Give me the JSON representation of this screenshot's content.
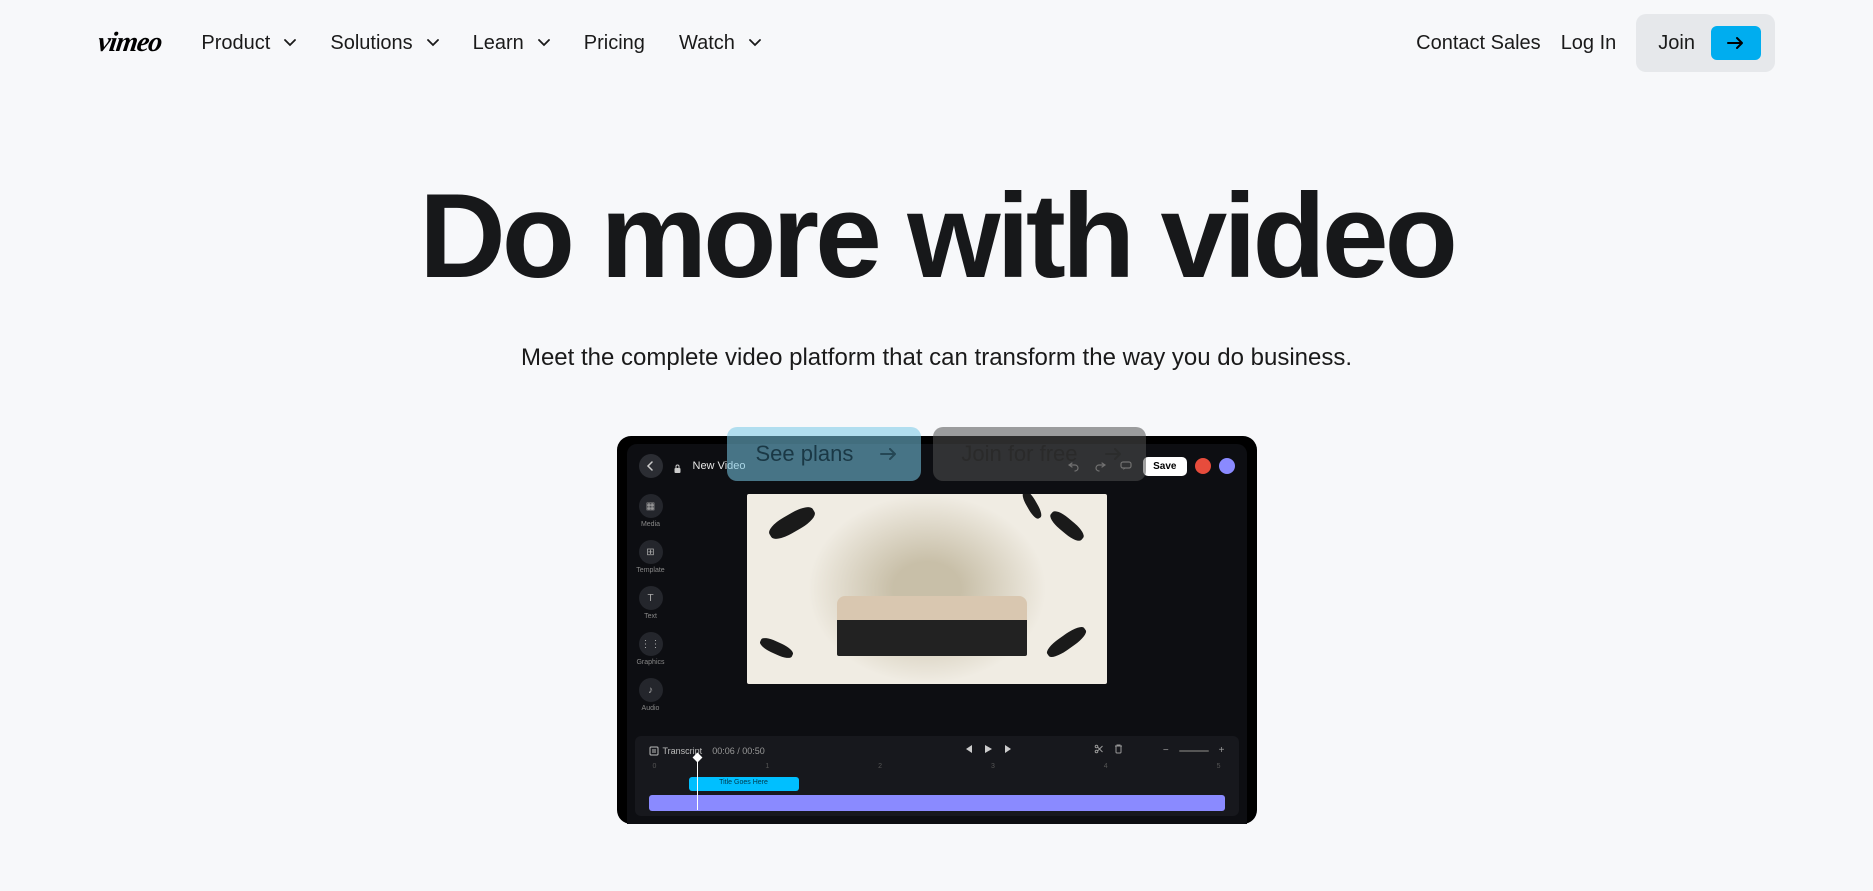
{
  "nav": {
    "logo": "vimeo",
    "items": [
      {
        "label": "Product",
        "hasDropdown": true
      },
      {
        "label": "Solutions",
        "hasDropdown": true
      },
      {
        "label": "Learn",
        "hasDropdown": true
      },
      {
        "label": "Pricing",
        "hasDropdown": false
      },
      {
        "label": "Watch",
        "hasDropdown": true
      }
    ],
    "contact": "Contact Sales",
    "login": "Log In",
    "join": "Join"
  },
  "hero": {
    "title": "Do more with video",
    "subtitle": "Meet the complete video platform that can transform the way you do business."
  },
  "cta": {
    "primary": "See plans",
    "secondary": "Join for free"
  },
  "editor": {
    "title": "New Video",
    "save": "Save",
    "rail": [
      {
        "label": "Media",
        "glyph": "▦"
      },
      {
        "label": "Template",
        "glyph": "⊞"
      },
      {
        "label": "Text",
        "glyph": "T"
      },
      {
        "label": "Graphics",
        "glyph": "⋮⋮"
      },
      {
        "label": "Audio",
        "glyph": "♪"
      }
    ],
    "timeline": {
      "transcript": "Transcript",
      "time": "00:06 / 00:50",
      "clip": "Title Goes Here",
      "ruler": [
        "0",
        "1",
        "2",
        "3",
        "4",
        "5"
      ],
      "zoom_minus": "−",
      "zoom_plus": "+"
    }
  }
}
